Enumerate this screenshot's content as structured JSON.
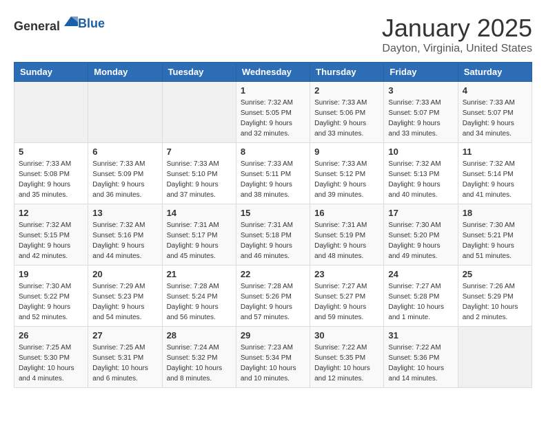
{
  "header": {
    "logo": {
      "text_general": "General",
      "text_blue": "Blue"
    },
    "title": "January 2025",
    "location": "Dayton, Virginia, United States"
  },
  "days_of_week": [
    "Sunday",
    "Monday",
    "Tuesday",
    "Wednesday",
    "Thursday",
    "Friday",
    "Saturday"
  ],
  "weeks": [
    {
      "days": [
        {
          "num": "",
          "info": ""
        },
        {
          "num": "",
          "info": ""
        },
        {
          "num": "",
          "info": ""
        },
        {
          "num": "1",
          "info": "Sunrise: 7:32 AM\nSunset: 5:05 PM\nDaylight: 9 hours and 32 minutes."
        },
        {
          "num": "2",
          "info": "Sunrise: 7:33 AM\nSunset: 5:06 PM\nDaylight: 9 hours and 33 minutes."
        },
        {
          "num": "3",
          "info": "Sunrise: 7:33 AM\nSunset: 5:07 PM\nDaylight: 9 hours and 33 minutes."
        },
        {
          "num": "4",
          "info": "Sunrise: 7:33 AM\nSunset: 5:07 PM\nDaylight: 9 hours and 34 minutes."
        }
      ]
    },
    {
      "days": [
        {
          "num": "5",
          "info": "Sunrise: 7:33 AM\nSunset: 5:08 PM\nDaylight: 9 hours and 35 minutes."
        },
        {
          "num": "6",
          "info": "Sunrise: 7:33 AM\nSunset: 5:09 PM\nDaylight: 9 hours and 36 minutes."
        },
        {
          "num": "7",
          "info": "Sunrise: 7:33 AM\nSunset: 5:10 PM\nDaylight: 9 hours and 37 minutes."
        },
        {
          "num": "8",
          "info": "Sunrise: 7:33 AM\nSunset: 5:11 PM\nDaylight: 9 hours and 38 minutes."
        },
        {
          "num": "9",
          "info": "Sunrise: 7:33 AM\nSunset: 5:12 PM\nDaylight: 9 hours and 39 minutes."
        },
        {
          "num": "10",
          "info": "Sunrise: 7:32 AM\nSunset: 5:13 PM\nDaylight: 9 hours and 40 minutes."
        },
        {
          "num": "11",
          "info": "Sunrise: 7:32 AM\nSunset: 5:14 PM\nDaylight: 9 hours and 41 minutes."
        }
      ]
    },
    {
      "days": [
        {
          "num": "12",
          "info": "Sunrise: 7:32 AM\nSunset: 5:15 PM\nDaylight: 9 hours and 42 minutes."
        },
        {
          "num": "13",
          "info": "Sunrise: 7:32 AM\nSunset: 5:16 PM\nDaylight: 9 hours and 44 minutes."
        },
        {
          "num": "14",
          "info": "Sunrise: 7:31 AM\nSunset: 5:17 PM\nDaylight: 9 hours and 45 minutes."
        },
        {
          "num": "15",
          "info": "Sunrise: 7:31 AM\nSunset: 5:18 PM\nDaylight: 9 hours and 46 minutes."
        },
        {
          "num": "16",
          "info": "Sunrise: 7:31 AM\nSunset: 5:19 PM\nDaylight: 9 hours and 48 minutes."
        },
        {
          "num": "17",
          "info": "Sunrise: 7:30 AM\nSunset: 5:20 PM\nDaylight: 9 hours and 49 minutes."
        },
        {
          "num": "18",
          "info": "Sunrise: 7:30 AM\nSunset: 5:21 PM\nDaylight: 9 hours and 51 minutes."
        }
      ]
    },
    {
      "days": [
        {
          "num": "19",
          "info": "Sunrise: 7:30 AM\nSunset: 5:22 PM\nDaylight: 9 hours and 52 minutes."
        },
        {
          "num": "20",
          "info": "Sunrise: 7:29 AM\nSunset: 5:23 PM\nDaylight: 9 hours and 54 minutes."
        },
        {
          "num": "21",
          "info": "Sunrise: 7:28 AM\nSunset: 5:24 PM\nDaylight: 9 hours and 56 minutes."
        },
        {
          "num": "22",
          "info": "Sunrise: 7:28 AM\nSunset: 5:26 PM\nDaylight: 9 hours and 57 minutes."
        },
        {
          "num": "23",
          "info": "Sunrise: 7:27 AM\nSunset: 5:27 PM\nDaylight: 9 hours and 59 minutes."
        },
        {
          "num": "24",
          "info": "Sunrise: 7:27 AM\nSunset: 5:28 PM\nDaylight: 10 hours and 1 minute."
        },
        {
          "num": "25",
          "info": "Sunrise: 7:26 AM\nSunset: 5:29 PM\nDaylight: 10 hours and 2 minutes."
        }
      ]
    },
    {
      "days": [
        {
          "num": "26",
          "info": "Sunrise: 7:25 AM\nSunset: 5:30 PM\nDaylight: 10 hours and 4 minutes."
        },
        {
          "num": "27",
          "info": "Sunrise: 7:25 AM\nSunset: 5:31 PM\nDaylight: 10 hours and 6 minutes."
        },
        {
          "num": "28",
          "info": "Sunrise: 7:24 AM\nSunset: 5:32 PM\nDaylight: 10 hours and 8 minutes."
        },
        {
          "num": "29",
          "info": "Sunrise: 7:23 AM\nSunset: 5:34 PM\nDaylight: 10 hours and 10 minutes."
        },
        {
          "num": "30",
          "info": "Sunrise: 7:22 AM\nSunset: 5:35 PM\nDaylight: 10 hours and 12 minutes."
        },
        {
          "num": "31",
          "info": "Sunrise: 7:22 AM\nSunset: 5:36 PM\nDaylight: 10 hours and 14 minutes."
        },
        {
          "num": "",
          "info": ""
        }
      ]
    }
  ]
}
